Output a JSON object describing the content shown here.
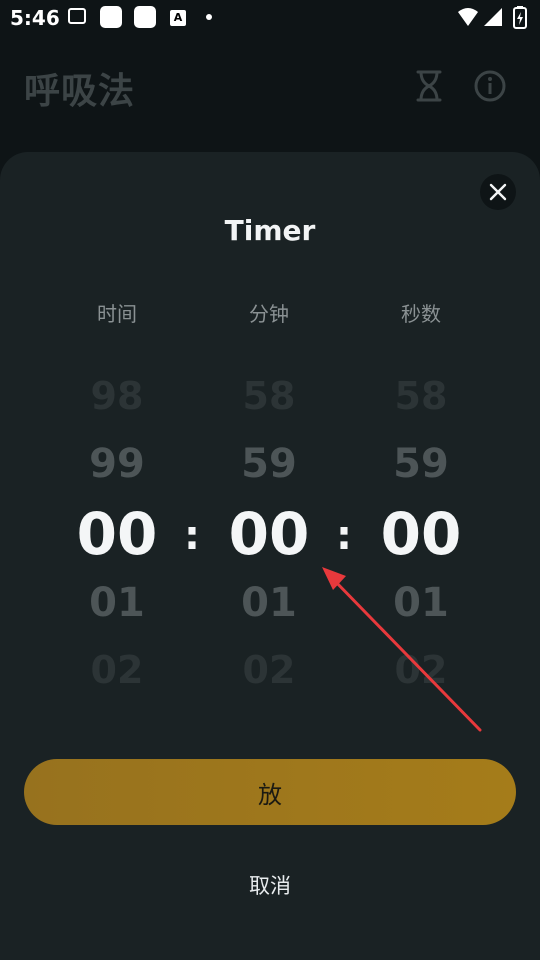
{
  "status_bar": {
    "time": "5:46",
    "a_label": "A"
  },
  "header": {
    "title": "呼吸法"
  },
  "timer_sheet": {
    "title": "Timer",
    "columns": [
      {
        "label": "时间",
        "values": [
          "98",
          "99",
          "00",
          "01",
          "02"
        ]
      },
      {
        "label": "分钟",
        "values": [
          "58",
          "59",
          "00",
          "01",
          "02"
        ]
      },
      {
        "label": "秒数",
        "values": [
          "58",
          "59",
          "00",
          "01",
          "02"
        ]
      }
    ],
    "separator": ":",
    "primary_button": "放",
    "cancel_button": "取消"
  },
  "colors": {
    "accent": "#a57c1a",
    "sheet": "#1a2224",
    "annotation_arrow": "#e8393c"
  }
}
